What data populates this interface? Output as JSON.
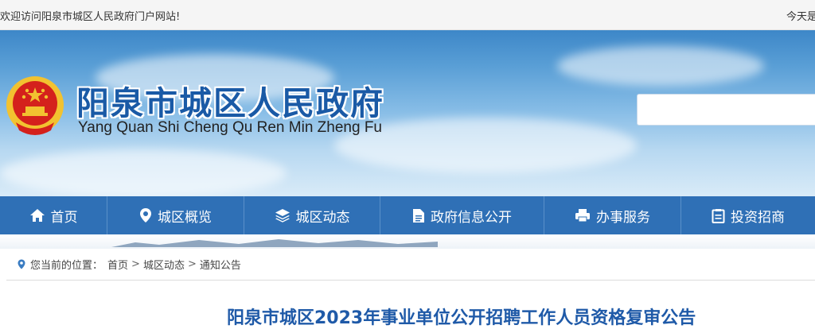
{
  "topbar": {
    "welcome": "欢迎访问阳泉市城区人民政府门户网站!",
    "today": "今天是"
  },
  "header": {
    "title": "阳泉市城区人民政府",
    "subtitle": "Yang Quan Shi Cheng Qu Ren Min Zheng Fu",
    "search_placeholder": ""
  },
  "nav": {
    "items": [
      {
        "label": "首页",
        "icon": "home-icon"
      },
      {
        "label": "城区概览",
        "icon": "location-pin-icon"
      },
      {
        "label": "城区动态",
        "icon": "layers-icon"
      },
      {
        "label": "政府信息公开",
        "icon": "document-icon"
      },
      {
        "label": "办事服务",
        "icon": "printer-icon"
      },
      {
        "label": "投资招商",
        "icon": "clipboard-icon"
      }
    ]
  },
  "breadcrumb": {
    "prefix": "您当前的位置：",
    "items": [
      "首页",
      "城区动态",
      "通知公告"
    ],
    "separator": ">"
  },
  "article": {
    "title": "阳泉市城区2023年事业单位公开招聘工作人员资格复审公告"
  },
  "colors": {
    "nav_bg": "#2f70b6",
    "title_blue": "#1a5aa6",
    "emblem_red": "#d4211c",
    "emblem_gold": "#f2c230"
  }
}
